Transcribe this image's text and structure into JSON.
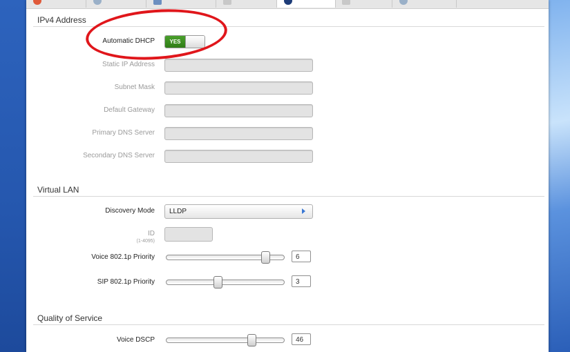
{
  "sections": {
    "ipv4": "IPv4 Address",
    "vlan": "Virtual LAN",
    "qos": "Quality of Service"
  },
  "ipv4": {
    "dhcp_label": "Automatic DHCP",
    "dhcp_state": "YES",
    "static_ip_label": "Static IP Address",
    "subnet_label": "Subnet Mask",
    "gateway_label": "Default Gateway",
    "dns1_label": "Primary DNS Server",
    "dns2_label": "Secondary DNS Server"
  },
  "vlan": {
    "discovery_label": "Discovery Mode",
    "discovery_value": "LLDP",
    "id_label": "ID",
    "id_hint": "(1-4095)",
    "voice_label": "Voice 802.1p Priority",
    "voice_value": "6",
    "sip_label": "SIP 802.1p Priority",
    "sip_value": "3"
  },
  "qos": {
    "dscp_label": "Voice DSCP",
    "dscp_value": "46"
  },
  "colors": {
    "toggle_on": "#3a9222",
    "annotation": "#e0161b",
    "accent": "#3a78d4"
  }
}
